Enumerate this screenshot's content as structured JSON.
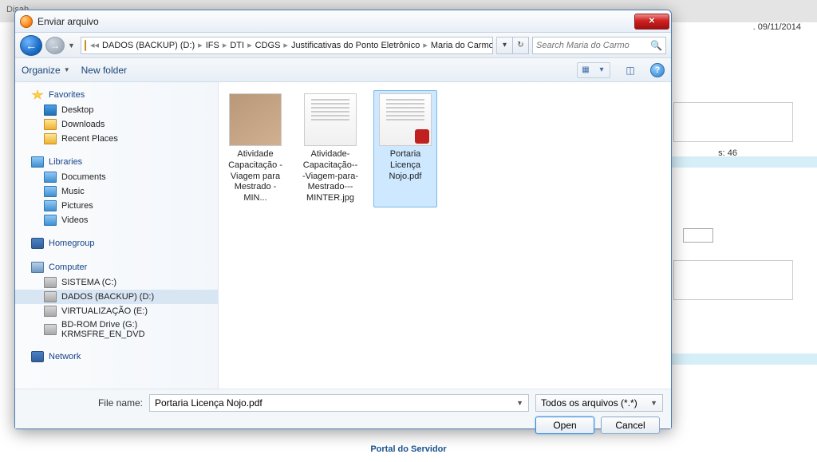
{
  "background": {
    "disable_label": "Disab",
    "date": ". 09/11/2014",
    "label46": "s: 46",
    "footer_main": "Portal do Servidor"
  },
  "dialog": {
    "title": "Enviar arquivo",
    "breadcrumb": [
      "DADOS (BACKUP) (D:)",
      "IFS",
      "DTI",
      "CDGS",
      "Justificativas do Ponto Eletrônico",
      "Maria do Carmo"
    ],
    "search_placeholder": "Search Maria do Carmo",
    "toolbar": {
      "organize": "Organize",
      "new_folder": "New folder"
    },
    "sidebar": {
      "favorites": {
        "header": "Favorites",
        "items": [
          "Desktop",
          "Downloads",
          "Recent Places"
        ]
      },
      "libraries": {
        "header": "Libraries",
        "items": [
          "Documents",
          "Music",
          "Pictures",
          "Videos"
        ]
      },
      "homegroup": {
        "header": "Homegroup"
      },
      "computer": {
        "header": "Computer",
        "items": [
          "SISTEMA (C:)",
          "DADOS (BACKUP) (D:)",
          "VIRTUALIZAÇÃO (E:)",
          "BD-ROM Drive (G:) KRMSFRE_EN_DVD"
        ]
      },
      "network": {
        "header": "Network"
      }
    },
    "files": [
      {
        "name": "Atividade Capacitação - Viagem para Mestrado - MIN...",
        "thumb": "scan",
        "selected": false
      },
      {
        "name": "Atividade-Capacitação---Viagem-para-Mestrado---MINTER.jpg",
        "thumb": "doc",
        "selected": false
      },
      {
        "name": "Portaria Licença Nojo.pdf",
        "thumb": "pdf",
        "selected": true
      }
    ],
    "footer": {
      "filename_label": "File name:",
      "filename_value": "Portaria Licença Nojo.pdf",
      "filter": "Todos os arquivos (*.*)",
      "open": "Open",
      "cancel": "Cancel"
    }
  }
}
